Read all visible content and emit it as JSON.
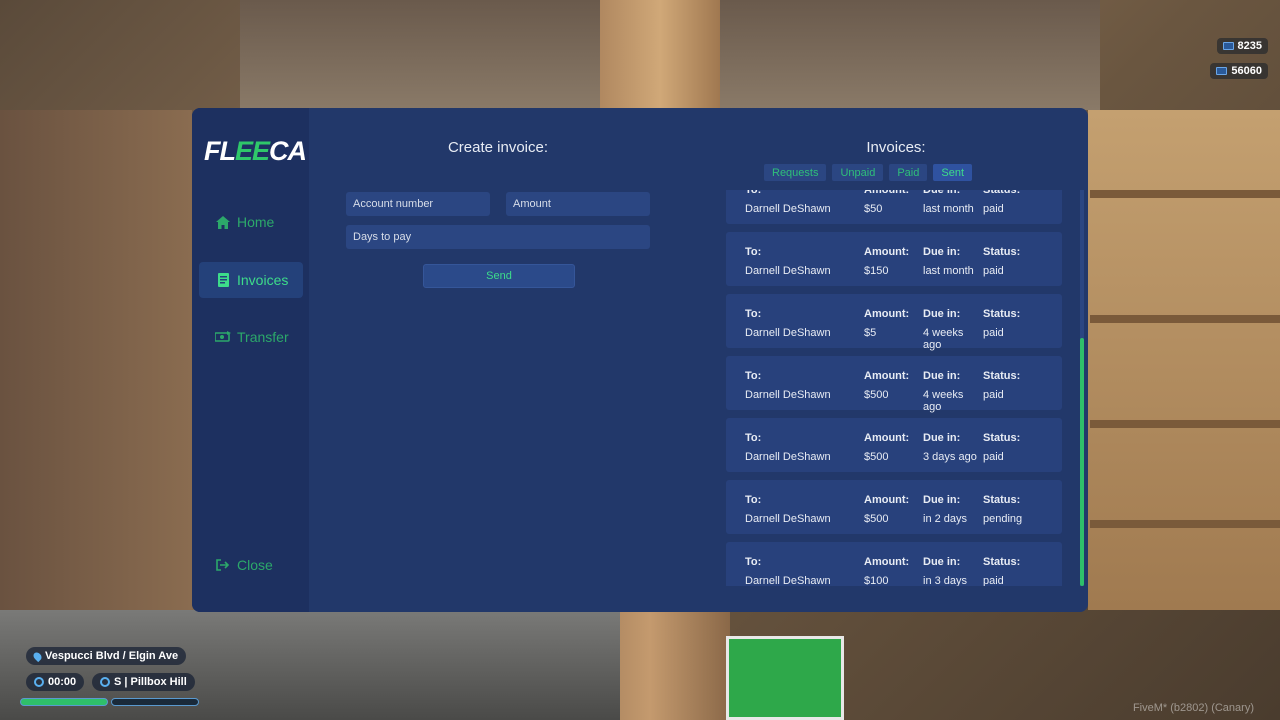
{
  "hud": {
    "cash": "8235",
    "bank": "56060",
    "street": "Vespucci Blvd / Elgin Ave",
    "time": "00:00",
    "district": "S | Pillbox Hill",
    "watermark": "FiveM* (b2802) (Canary)"
  },
  "logo": {
    "part1": "FL",
    "part2": "EE",
    "part3": "CA"
  },
  "nav": {
    "home": "Home",
    "invoices": "Invoices",
    "transfer": "Transfer",
    "close": "Close"
  },
  "create": {
    "title": "Create invoice:",
    "account_placeholder": "Account number",
    "amount_placeholder": "Amount",
    "days_placeholder": "Days to pay",
    "send_label": "Send"
  },
  "invoices": {
    "title": "Invoices:",
    "tabs": [
      "Requests",
      "Unpaid",
      "Paid",
      "Sent"
    ],
    "active_tab": "Sent",
    "headers": {
      "to": "To:",
      "amount": "Amount:",
      "due": "Due in:",
      "status": "Status:"
    },
    "items": [
      {
        "to": "Darnell DeShawn",
        "amount": "$50",
        "due": "last month",
        "status": "paid"
      },
      {
        "to": "Darnell DeShawn",
        "amount": "$150",
        "due": "last month",
        "status": "paid"
      },
      {
        "to": "Darnell DeShawn",
        "amount": "$5",
        "due": "4 weeks ago",
        "status": "paid"
      },
      {
        "to": "Darnell DeShawn",
        "amount": "$500",
        "due": "4 weeks ago",
        "status": "paid"
      },
      {
        "to": "Darnell DeShawn",
        "amount": "$500",
        "due": "3 days ago",
        "status": "paid"
      },
      {
        "to": "Darnell DeShawn",
        "amount": "$500",
        "due": "in 2 days",
        "status": "pending"
      },
      {
        "to": "Darnell DeShawn",
        "amount": "$100",
        "due": "in 3 days",
        "status": "paid"
      }
    ]
  },
  "colors": {
    "panel": "#22386a",
    "sidebar": "#1d3060",
    "accent": "#3ddc8a"
  }
}
